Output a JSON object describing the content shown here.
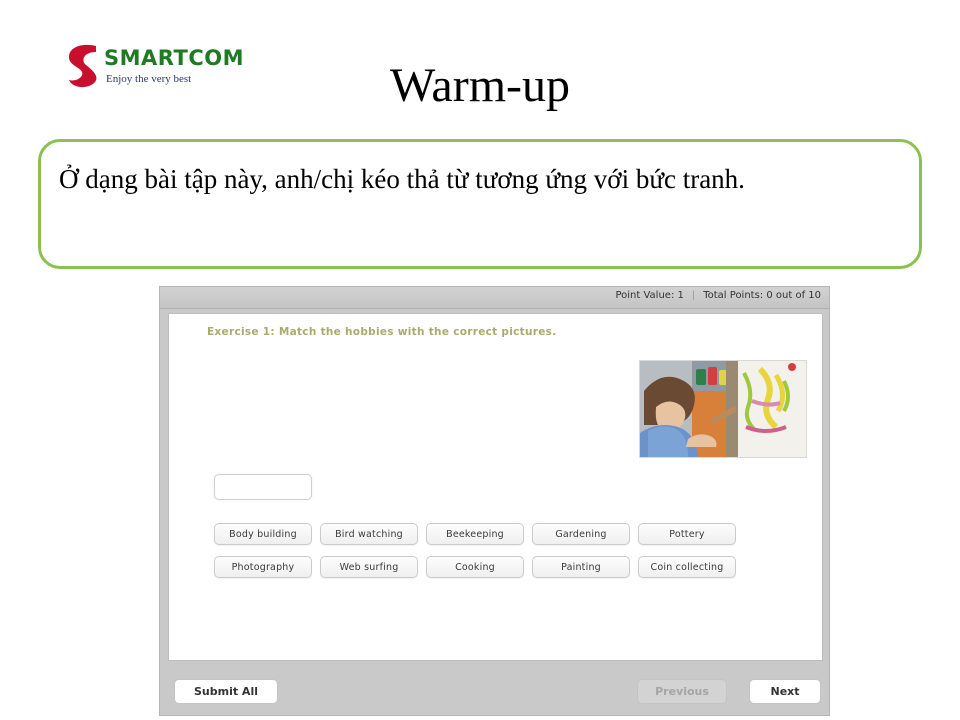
{
  "brand": {
    "name": "SMARTCOM",
    "tagline": "Enjoy the very best",
    "mark_icon": "smartcom-s-logo-icon",
    "name_color": "#1E7B24",
    "mark_color": "#C8102E",
    "tagline_color": "#2A3A6B"
  },
  "slide": {
    "title": "Warm-up",
    "callout_text": "Ở dạng bài tập này, anh/chị kéo thả từ tương ứng với bức tranh.",
    "callout_border_color": "#8CC152"
  },
  "player": {
    "header": {
      "point_value_label": "Point Value: 1",
      "separator": "|",
      "total_points_label": "Total Points: 0 out of 10"
    },
    "exercise": {
      "prompt": "Exercise 1: Match the hobbies with the correct pictures.",
      "prompt_color": "#a8ab6b",
      "image_alt": "child-painting-on-easel-photo",
      "drop_target_value": ""
    },
    "hobbies": [
      [
        "Body building",
        "Bird watching",
        "Beekeeping",
        "Gardening",
        "Pottery"
      ],
      [
        "Photography",
        "Web surfing",
        "Cooking",
        "Painting",
        "Coin collecting"
      ]
    ],
    "footer": {
      "submit_label": "Submit All",
      "previous_label": "Previous",
      "next_label": "Next",
      "previous_disabled": true
    }
  }
}
